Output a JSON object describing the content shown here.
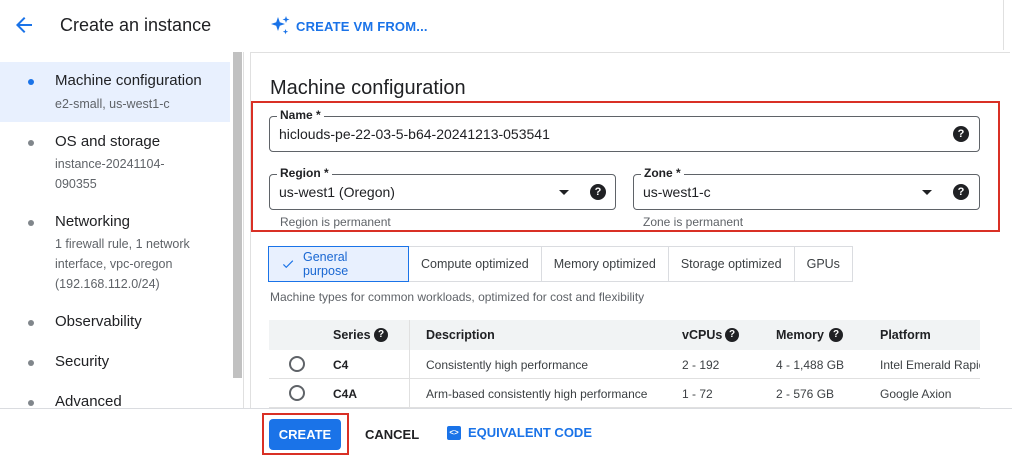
{
  "header": {
    "title": "Create an instance",
    "create_vm_label": "CREATE VM FROM..."
  },
  "sidebar": {
    "items": [
      {
        "label": "Machine configuration",
        "sub": "e2-small, us-west1-c",
        "active": true
      },
      {
        "label": "OS and storage",
        "sub": "instance-20241104-090355"
      },
      {
        "label": "Networking",
        "sub": "1 firewall rule, 1 network interface, vpc-oregon (192.168.112.0/24)"
      },
      {
        "label": "Observability",
        "sub": ""
      },
      {
        "label": "Security",
        "sub": ""
      },
      {
        "label": "Advanced",
        "sub": ""
      }
    ]
  },
  "main": {
    "title": "Machine configuration",
    "name_field": {
      "label": "Name *",
      "value": "hiclouds-pe-22-03-5-b64-20241213-053541"
    },
    "region_field": {
      "label": "Region *",
      "value": "us-west1 (Oregon)",
      "hint": "Region is permanent"
    },
    "zone_field": {
      "label": "Zone *",
      "value": "us-west1-c",
      "hint": "Zone is permanent"
    },
    "tabs": [
      "General purpose",
      "Compute optimized",
      "Memory optimized",
      "Storage optimized",
      "GPUs"
    ],
    "tab_description": "Machine types for common workloads, optimized for cost and flexibility",
    "table": {
      "headers": {
        "series": "Series",
        "description": "Description",
        "vcpus": "vCPUs",
        "memory": "Memory",
        "platform": "Platform"
      },
      "rows": [
        {
          "series": "C4",
          "description": "Consistently high performance",
          "vcpus": "2 - 192",
          "memory": "4 - 1,488 GB",
          "platform": "Intel Emerald Rapids"
        },
        {
          "series": "C4A",
          "description": "Arm-based consistently high performance",
          "vcpus": "1 - 72",
          "memory": "2 - 576 GB",
          "platform": "Google Axion"
        }
      ]
    }
  },
  "footer": {
    "create_label": "CREATE",
    "cancel_label": "CANCEL",
    "equivalent_code_label": "EQUIVALENT CODE"
  },
  "colors": {
    "accent": "#1a73e8",
    "highlight": "#d93025",
    "active_bg": "#e8f0fe"
  }
}
